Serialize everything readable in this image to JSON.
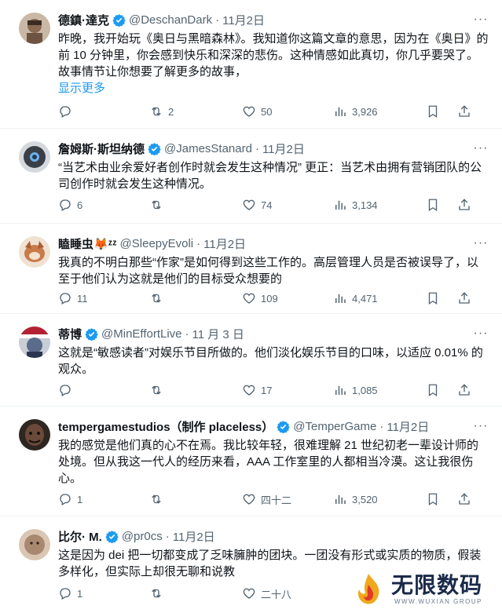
{
  "tweets": [
    {
      "name": "德鎮·達克",
      "handle": "@DeschanDark",
      "date": "11月2日",
      "verified": true,
      "text": "昨晚，我开始玩《奥日与黑暗森林》。我知道你这篇文章的意思，因为在《奥日》的前 10 分钟里，你会感到快乐和深深的悲伤。这种情感如此真切，你几乎要哭了。故事情节让你想要了解更多的故事，",
      "show_more": "显示更多",
      "replies": "",
      "retweets": "2",
      "likes": "50",
      "views": "3,926",
      "avatar_color": "#8a6a52"
    },
    {
      "name": "詹姆斯·斯坦纳德",
      "handle": "@JamesStanard",
      "date": "11月2日",
      "verified": true,
      "text": "“当艺术由业余爱好者创作时就会发生这种情况” 更正：当艺术由拥有营销团队的公司创作时就会发生这种情况。",
      "show_more": "",
      "replies": "6",
      "retweets": "",
      "likes": "74",
      "views": "3,134",
      "avatar_color": "#3a3f47"
    },
    {
      "name": "瞌睡虫🦊ᶻᶻ",
      "handle": "@SleepyEvoli",
      "date": "11月2日",
      "verified": false,
      "text": "我真的不明白那些“作家”是如何得到这些工作的。高层管理人员是否被误导了，以至于他们认为这就是他们的目标受众想要的",
      "show_more": "",
      "replies": "11",
      "retweets": "",
      "likes": "109",
      "views": "4,471",
      "avatar_color": "#c97b4a"
    },
    {
      "name": "蒂博",
      "handle": "@MinEffortLive",
      "date": "11 月 3 日",
      "verified": true,
      "text": "这就是“敏感读者”对娱乐节目所做的。他们淡化娱乐节目的口味，以适应 0.01% 的观众。",
      "show_more": "",
      "replies": "",
      "retweets": "",
      "likes": "17",
      "views": "1,085",
      "avatar_color": "#5b6b8a"
    },
    {
      "name": "tempergamestudios（制作 placeless）",
      "handle": "@TemperGame",
      "date": "11月2日",
      "verified": true,
      "text": "我的感觉是他们真的心不在焉。我比较年轻，很难理解 21 世纪初老一辈设计师的处境。但从我这一代人的经历来看，AAA 工作室里的人都相当冷漠。这让我很伤心。",
      "show_more": "",
      "replies": "1",
      "retweets": "",
      "likes": "四十二",
      "views": "3,520",
      "avatar_color": "#6b4a3a"
    },
    {
      "name": "比尔· M.",
      "handle": "@pr0cs",
      "date": "11月2日",
      "verified": true,
      "text": "这是因为 dei 把一切都变成了乏味臃肿的团块。一团没有形式或实质的物质，假装多样化，但实际上却很无聊和说教",
      "show_more": "",
      "replies": "1",
      "retweets": "",
      "likes": "二十八",
      "views": "",
      "avatar_color": "#a88870"
    }
  ],
  "watermark": {
    "title": "无限数码",
    "subtitle": "WWW.WUXIAN GROUP"
  },
  "colors": {
    "text": "#0f1419",
    "secondary": "#536471",
    "link": "#1d9bf0",
    "verified": "#1d9bf0",
    "divider": "#eff3f4"
  }
}
